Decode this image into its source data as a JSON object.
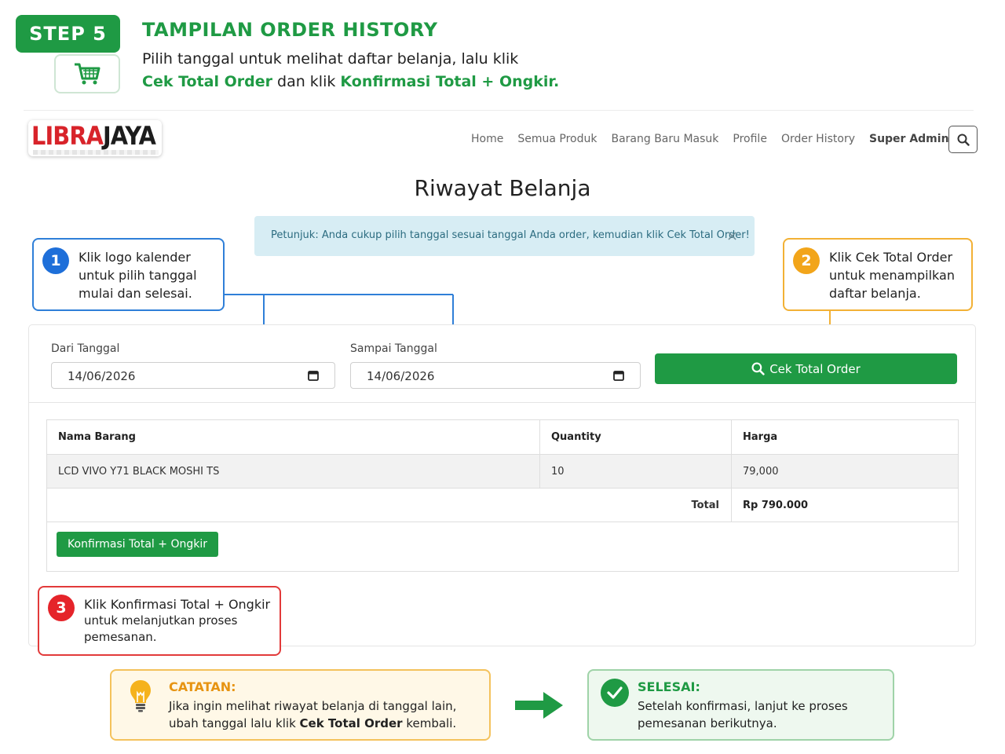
{
  "step": {
    "badge": "STEP 5",
    "title": "TAMPILAN ORDER HISTORY",
    "desc_line1": "Pilih tanggal untuk melihat daftar belanja, lalu klik",
    "desc_bold1": "Cek Total Order",
    "desc_mid": " dan klik ",
    "desc_bold2": "Konfirmasi Total + Ongkir."
  },
  "logo": {
    "part1": "LIBRA",
    "part2": "JAYA"
  },
  "nav": {
    "items": [
      "Home",
      "Semua Produk",
      "Barang Baru Masuk",
      "Profile",
      "Order History"
    ],
    "admin_label": "Super Admin"
  },
  "page": {
    "title": "Riwayat Belanja",
    "alert": "Petunjuk: Anda cukup pilih tanggal sesuai tanggal Anda order, kemudian klik Cek Total Order!",
    "alert_close": "×"
  },
  "callouts": {
    "c1": {
      "num": "1",
      "l1": "Klik logo kalender",
      "l2": "untuk pilih tanggal",
      "l3": "mulai dan selesai."
    },
    "c2": {
      "num": "2",
      "l1": "Klik Cek Total Order",
      "l2": "untuk menampilkan",
      "l3": "daftar belanja."
    },
    "c3": {
      "num": "3",
      "l1": "Klik Konfirmasi Total + Ongkir",
      "l2": "untuk melanjutkan proses",
      "l3": "pemesanan."
    }
  },
  "form": {
    "from_label": "Dari Tanggal",
    "from_value": "14/06/2026",
    "to_label": "Sampai Tanggal",
    "to_value": "14/06/2026",
    "cek_button": "Cek Total Order"
  },
  "table": {
    "headers": [
      "Nama Barang",
      "Quantity",
      "Harga"
    ],
    "rows": [
      {
        "nama": "LCD VIVO Y71 BLACK MOSHI TS",
        "qty": "10",
        "harga": "79,000"
      }
    ],
    "total_label": "Total",
    "total_value": "Rp 790.000",
    "konfirmasi_button": "Konfirmasi Total + Ongkir"
  },
  "notes": {
    "catatan_title": "CATATAN:",
    "catatan_l1": "Jika ingin melihat riwayat belanja di tanggal lain,",
    "catatan_l2_pre": "ubah tanggal lalu klik ",
    "catatan_l2_bold": "Cek Total Order",
    "catatan_l2_post": " kembali.",
    "selesai_title": "SELESAI:",
    "selesai_l1": "Setelah konfirmasi, lanjut ke proses",
    "selesai_l2": "pemesanan berikutnya."
  },
  "colors": {
    "brand_green": "#1f9a44",
    "callout_blue": "#2f7fd8",
    "callout_orange": "#f2b135",
    "callout_red": "#e23a3a",
    "alert_bg": "#d7edf4"
  },
  "icons": [
    "cart-icon",
    "search-icon",
    "calendar-icon",
    "close-icon",
    "lightbulb-icon",
    "check-icon",
    "arrow-right-icon",
    "caret-down-icon"
  ]
}
